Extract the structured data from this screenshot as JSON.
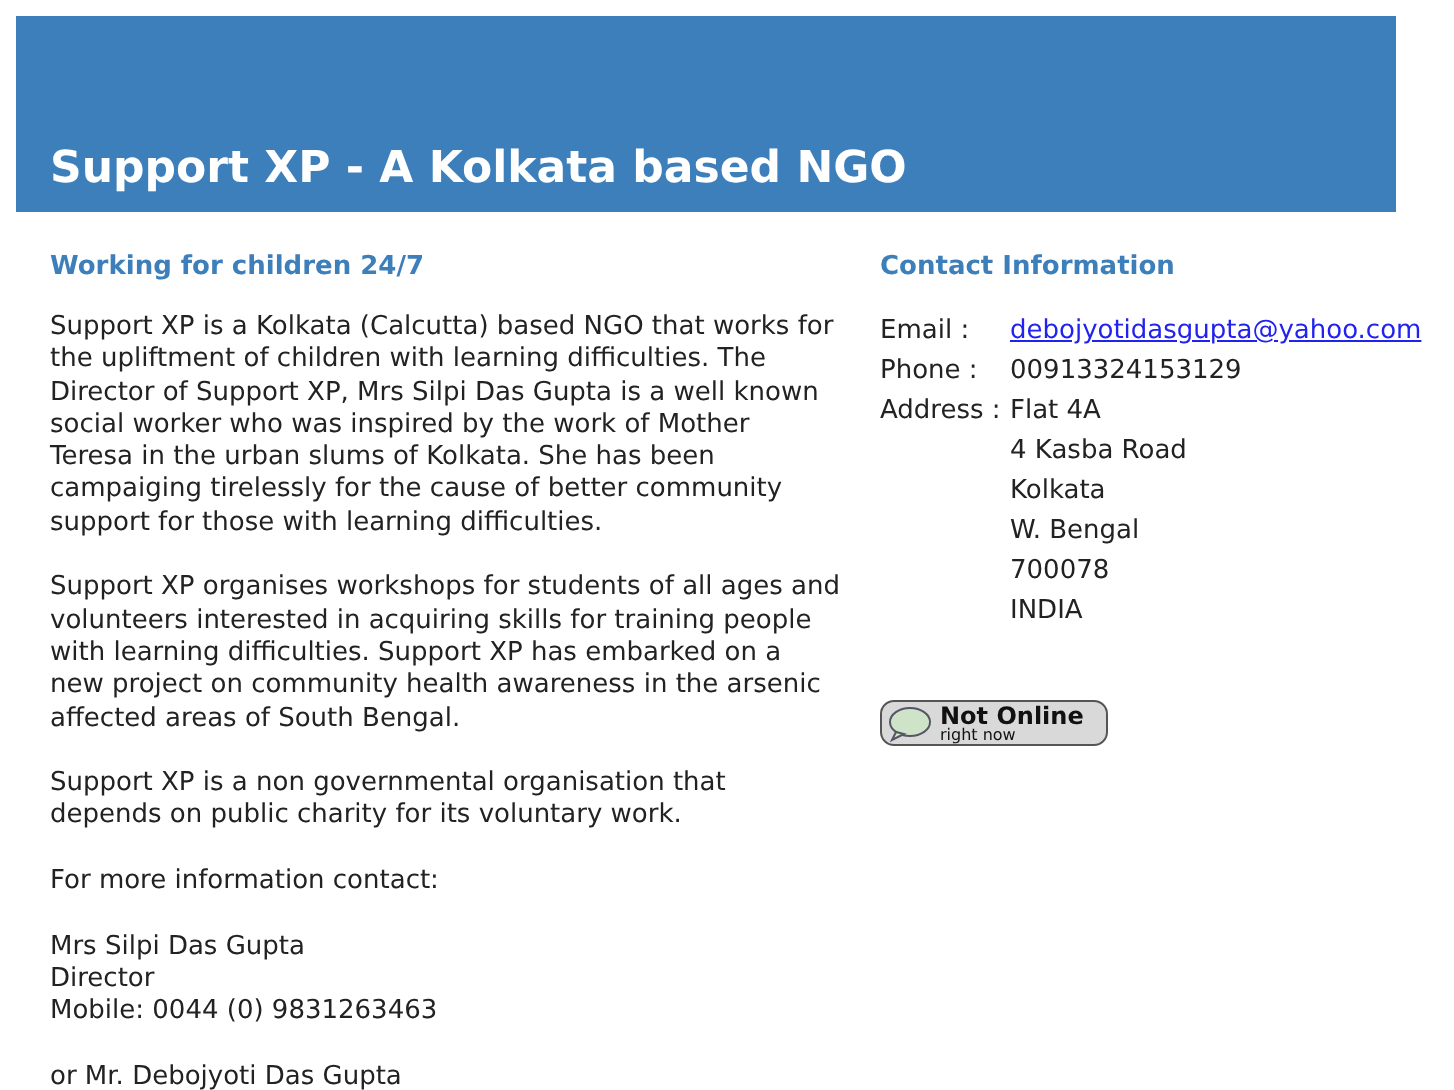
{
  "header": {
    "title": "Support XP - A Kolkata based NGO"
  },
  "main": {
    "heading": "Working for children 24/7",
    "paragraphs": [
      "Support XP is a Kolkata (Calcutta) based NGO that works for the upliftment of children with learning difficulties. The Director of Support XP, Mrs Silpi Das Gupta is a well known social worker who  was inspired by the work of Mother Teresa in the urban slums of Kolkata. She has been campaiging tirelessly for the cause of better community support for those with learning difficulties.",
      "Support XP organises workshops for students of all ages and volunteers interested in acquiring skills for training people with learning difficulties. Support XP has embarked on a new project on community health awareness in the arsenic affected areas of South Bengal.",
      "Support XP is a non governmental organisation that depends on public charity for its voluntary work.",
      "For more information contact:"
    ],
    "contact_lines": [
      "Mrs Silpi Das Gupta",
      "Director",
      "Mobile: 0044 (0) 9831263463"
    ],
    "more": "or Mr. Debojyoti Das Gupta"
  },
  "contact": {
    "heading": "Contact Information",
    "rows": [
      {
        "label": "Email :",
        "kind": "link",
        "lines": [
          "debojyotidasgupta@yahoo.com"
        ]
      },
      {
        "label": "Phone :",
        "kind": "text",
        "lines": [
          "00913324153129"
        ]
      },
      {
        "label": "Address :",
        "kind": "text",
        "lines": [
          "Flat 4A",
          "4 Kasba Road",
          "Kolkata",
          "W. Bengal",
          "700078",
          "INDIA"
        ]
      }
    ],
    "status_badge": {
      "title": "Not Online",
      "subtitle": "right now"
    }
  }
}
